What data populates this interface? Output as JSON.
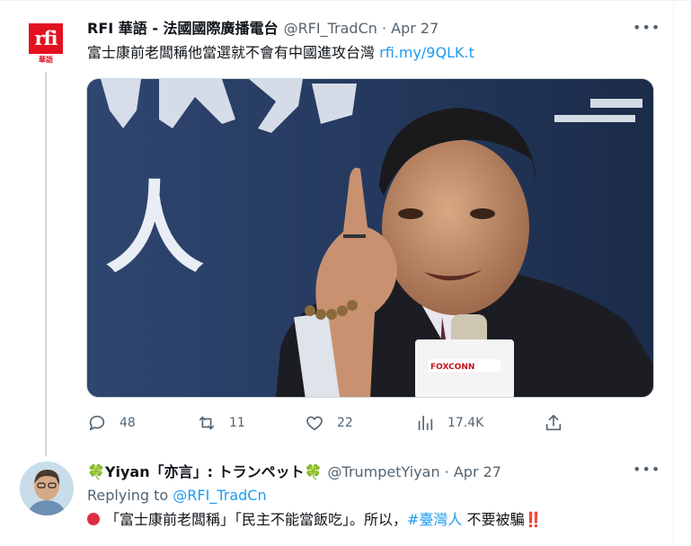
{
  "tweets": [
    {
      "author_name": "RFI 華語 - 法國國際廣播電台",
      "handle": "@RFI_TradCn",
      "date": "Apr 27",
      "header_meta": "@RFI_TradCn · Apr 27",
      "avatar_text": "rfi",
      "avatar_subtext": "華語",
      "text": "富士康前老闆稱他當選就不會有中國進攻台灣",
      "link": "rfi.my/9QLK.t",
      "media_overlay_text": "人",
      "mic_label": "FOXCONN",
      "stats": {
        "replies": "48",
        "retweets": "11",
        "likes": "22",
        "views": "17.4K"
      }
    },
    {
      "author_name_prefix": "Yiyan「亦言」: トランペット",
      "handle": "@TrumpetYiyan",
      "date": "Apr 27",
      "header_meta": "@TrumpetYiyan · Apr 27",
      "replying_label": "Replying to",
      "replying_handle": "@RFI_TradCn",
      "text_part1": "「富士康前老闆稱」「民主不能當飯吃」。所以，",
      "hashtag": "#臺灣人",
      "text_part2": " 不要被騙",
      "exclaim": "‼️"
    }
  ],
  "icons": {
    "more": "more-horizontal-icon",
    "reply": "reply-icon",
    "retweet": "retweet-icon",
    "like": "heart-icon",
    "views": "views-chart-icon",
    "share": "share-icon",
    "clover": "four-leaf-clover-icon"
  },
  "colors": {
    "accent": "#1d9bf0",
    "text": "#0f1419",
    "muted": "#536471",
    "rfi_red": "#e3101f"
  }
}
